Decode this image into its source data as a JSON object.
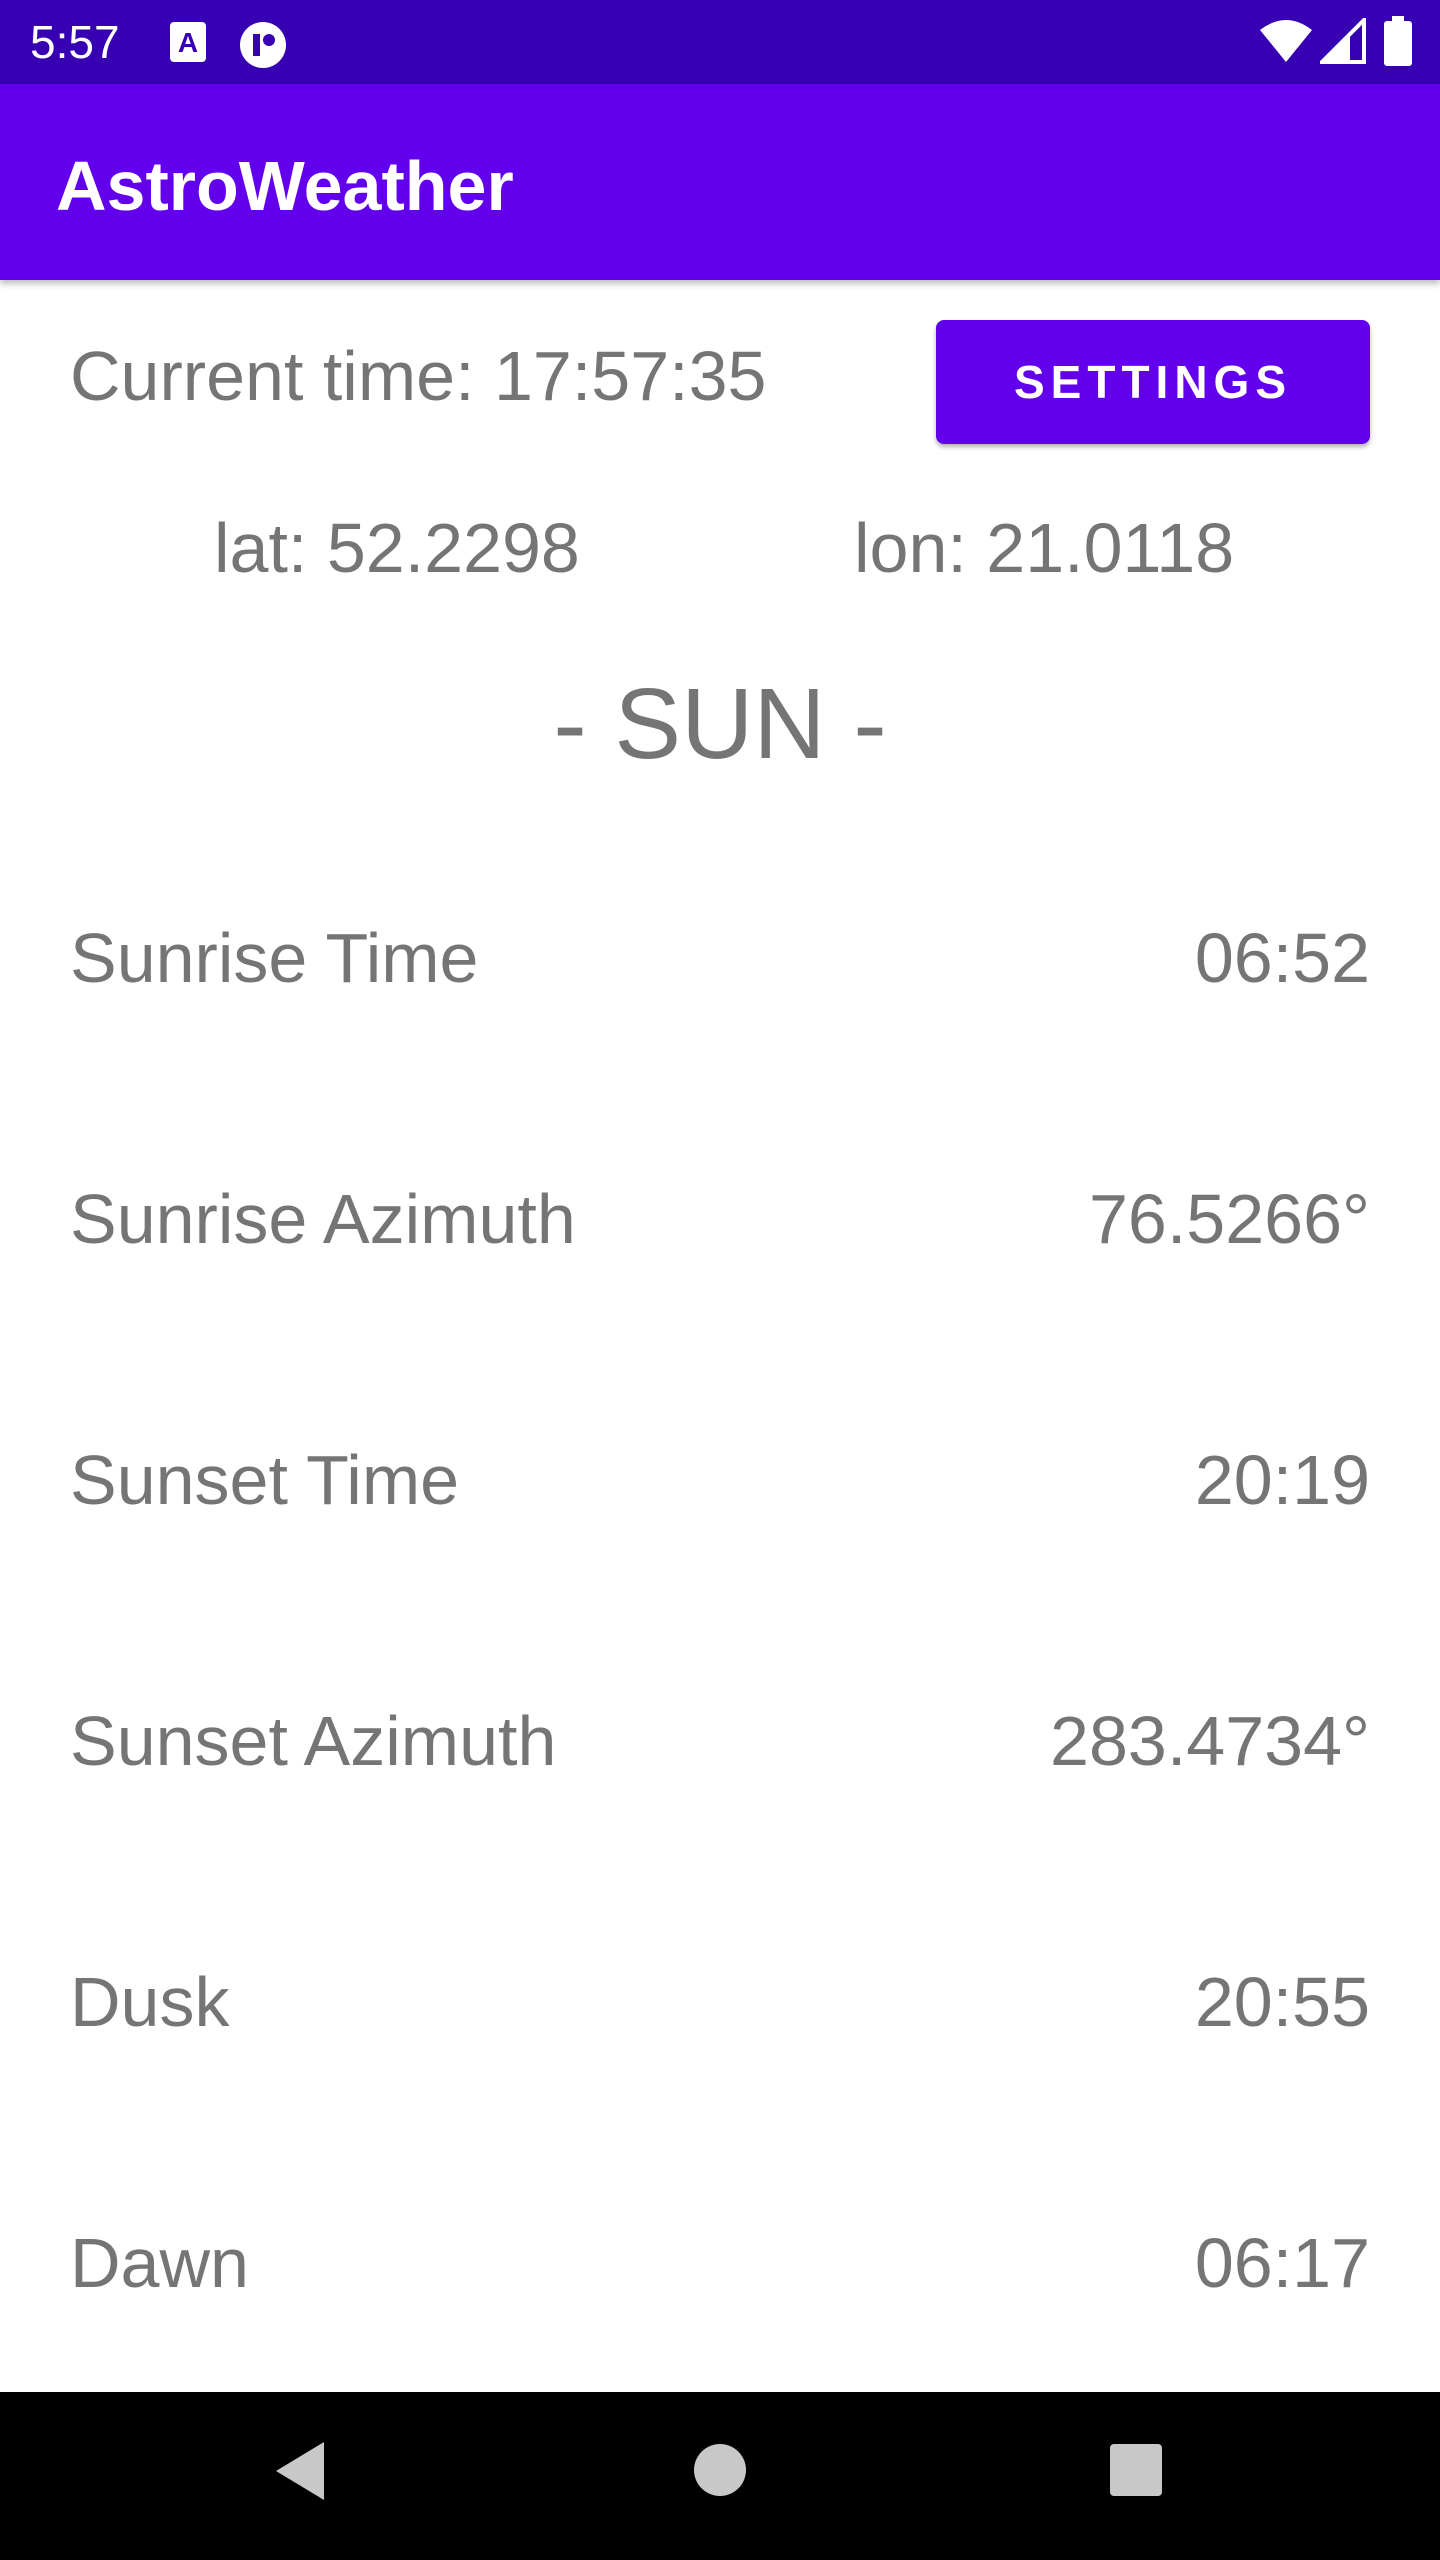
{
  "status_bar": {
    "time": "5:57",
    "left_icons": [
      "a-notification-icon",
      "app-notification-icon"
    ],
    "right_icons": [
      "wifi-icon",
      "signal-icon",
      "battery-icon"
    ]
  },
  "app_bar": {
    "title": "AstroWeather"
  },
  "header": {
    "current_time": "Current time: 17:57:35",
    "settings_label": "SETTINGS"
  },
  "location": {
    "lat": "lat: 52.2298",
    "lon": "lon: 21.0118"
  },
  "section": {
    "title": "- SUN -"
  },
  "rows": [
    {
      "label": "Sunrise Time",
      "value": "06:52"
    },
    {
      "label": "Sunrise Azimuth",
      "value": "76.5266°"
    },
    {
      "label": "Sunset Time",
      "value": "20:19"
    },
    {
      "label": "Sunset Azimuth",
      "value": "283.4734°"
    },
    {
      "label": "Dusk",
      "value": "20:55"
    },
    {
      "label": "Dawn",
      "value": "06:17"
    }
  ],
  "nav_bar": {
    "icons": [
      "back-icon",
      "home-icon",
      "recents-icon"
    ]
  },
  "colors": {
    "status_bar": "#3700B3",
    "primary": "#6200EE",
    "text": "#757575"
  }
}
